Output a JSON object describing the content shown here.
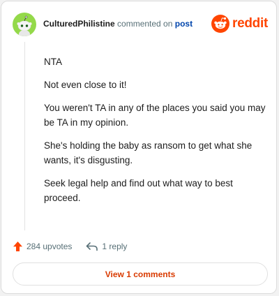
{
  "header": {
    "username": "CulturedPhilistine",
    "action_text": "commented on",
    "link_text": "post",
    "logo_text": "reddit"
  },
  "comment": {
    "paragraphs": [
      "NTA",
      "Not even close to it!",
      "You weren't TA in any of the places you said you may be TA in my opinion.",
      "She's holding the baby as ransom to get what she wants, it's disgusting.",
      "Seek legal help and find out what way to best proceed."
    ]
  },
  "actions": {
    "upvotes": "284 upvotes",
    "reply": "1 reply"
  },
  "view_comments_label": "View 1 comments",
  "icons": {
    "avatar": "snoo-avatar-icon",
    "logo": "reddit-logo-icon",
    "upvote": "upvote-arrow-icon",
    "reply": "reply-arrow-icon"
  },
  "colors": {
    "brand": "#ff4500",
    "avatar_bg": "#94d94a",
    "link": "#0045ac",
    "view_comments": "#d93a00",
    "upvote": "#ff4500"
  }
}
